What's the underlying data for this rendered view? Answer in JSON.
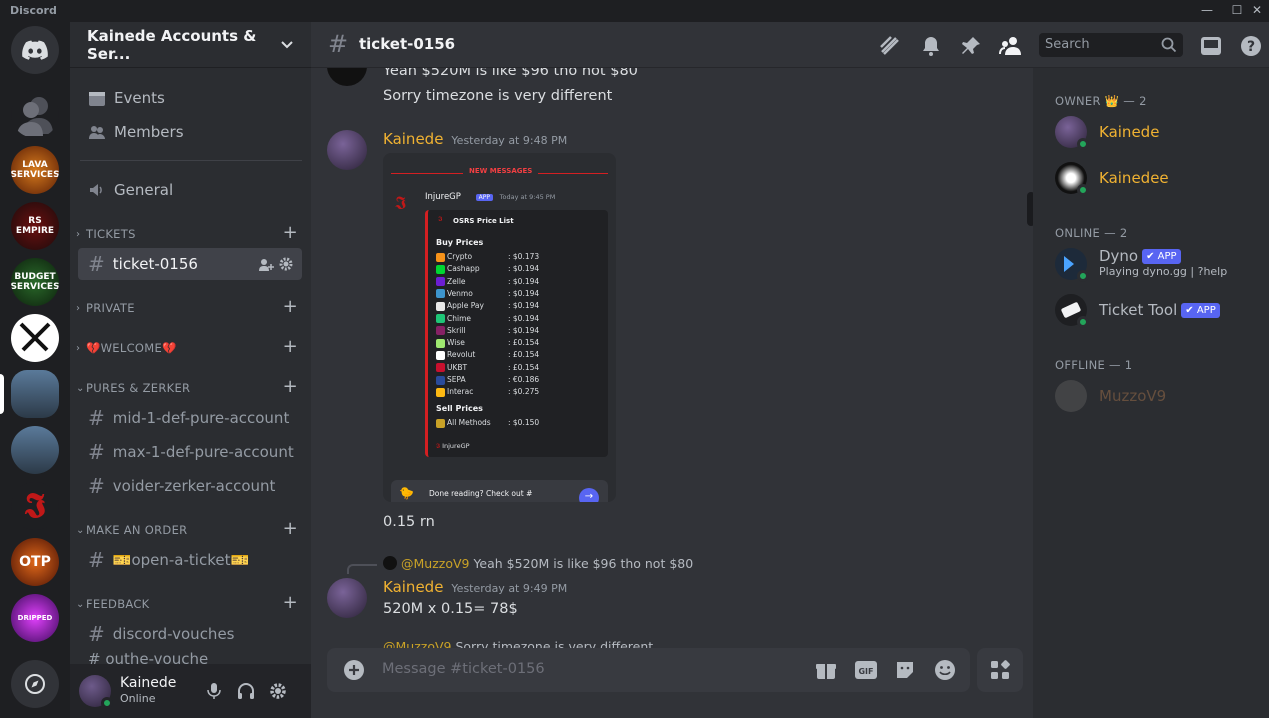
{
  "app": {
    "title": "Discord"
  },
  "window": {
    "min": "—",
    "max": "☐",
    "close": "✕"
  },
  "guild_icons": [
    {
      "name": "home",
      "label": ""
    },
    {
      "name": "dm-avatar",
      "label": ""
    },
    {
      "name": "lava-services",
      "label": "LAVA SERVICES"
    },
    {
      "name": "rs-empire",
      "label": "RS EMPIRE"
    },
    {
      "name": "budget-services",
      "label": "BUDGET SERVICES"
    },
    {
      "name": "swords",
      "label": ""
    },
    {
      "name": "kainede-1",
      "label": ""
    },
    {
      "name": "kainede-2",
      "label": ""
    },
    {
      "name": "injure",
      "label": ""
    },
    {
      "name": "otp",
      "label": "OTP"
    },
    {
      "name": "dripped",
      "label": "DRIPPED"
    }
  ],
  "server": {
    "name": "Kainede Accounts & Ser..."
  },
  "nav": {
    "events": "Events",
    "members": "Members"
  },
  "channels": {
    "general": "General",
    "cat_tickets": "TICKETS",
    "ticket": "ticket-0156",
    "cat_private": "PRIVATE",
    "cat_welcome": "💔WELCOME💔",
    "cat_pures": "PURES & ZERKER",
    "mid_pure": "mid-1-def-pure-account",
    "max_pure": "max-1-def-pure-account",
    "voider": "voider-zerker-account",
    "cat_order": "MAKE AN ORDER",
    "open_ticket": "🎫open-a-ticket🎫",
    "cat_feedback": "FEEDBACK",
    "vouches": "discord-vouches",
    "partial": "# outhe-vouche"
  },
  "user": {
    "name": "Kainede",
    "status": "Online"
  },
  "topbar": {
    "channel": "ticket-0156",
    "search_placeholder": "Search"
  },
  "messages": {
    "line1": "Yeah $520M is like $96 tho not $80",
    "line2": "Sorry timezone is very different",
    "author1": "Kainede",
    "time1": "Yesterday at 9:48 PM",
    "after_embed": "0.15 rn",
    "reply_user": "@MuzzoV9",
    "reply_text": "Yeah $520M is like $96 tho not $80",
    "author2": "Kainede",
    "time2": "Yesterday at 9:49 PM",
    "calc": "520M x 0.15= 78$",
    "partial_reply_user": "@MuzzoV9",
    "partial_reply_text": "Sorry timezone is very different"
  },
  "embed": {
    "new_messages": "NEW MESSAGES",
    "bot": "InjureGP",
    "app": "APP",
    "time": "Today at 9:45 PM",
    "title": "OSRS Price List",
    "buy_header": "Buy Prices",
    "buy": [
      {
        "method": "Crypto",
        "price": ": $0.173",
        "color": "#f7931a"
      },
      {
        "method": "Cashapp",
        "price": ": $0.194",
        "color": "#00d632"
      },
      {
        "method": "Zelle",
        "price": ": $0.194",
        "color": "#6d1ed4"
      },
      {
        "method": "Venmo",
        "price": ": $0.194",
        "color": "#3d95ce"
      },
      {
        "method": "Apple Pay",
        "price": ": $0.194",
        "color": "#e8e8e8"
      },
      {
        "method": "Chime",
        "price": ": $0.194",
        "color": "#1ec677"
      },
      {
        "method": "Skrill",
        "price": ": $0.194",
        "color": "#862165"
      },
      {
        "method": "Wise",
        "price": ": £0.154",
        "color": "#9fe870"
      },
      {
        "method": "Revolut",
        "price": ": £0.154",
        "color": "#ffffff"
      },
      {
        "method": "UKBT",
        "price": ": £0.154",
        "color": "#c8102e"
      },
      {
        "method": "SEPA",
        "price": ": €0.186",
        "color": "#2a4b9b"
      },
      {
        "method": "Interac",
        "price": ": $0.275",
        "color": "#fdb913"
      }
    ],
    "sell_header": "Sell Prices",
    "sell": [
      {
        "method": "All Methods",
        "price": ": $0.150",
        "color": "#c9a227"
      }
    ],
    "footer": "InjureGP",
    "done": "Done reading? Check out #"
  },
  "composer": {
    "placeholder": "Message #ticket-0156"
  },
  "member_list": {
    "owner_header": "OWNER 👑 — 2",
    "owners": [
      {
        "name": "Kainede",
        "color": "#f0b232"
      },
      {
        "name": "Kainedee",
        "color": "#f0b232"
      }
    ],
    "online_header": "ONLINE — 2",
    "online": [
      {
        "name": "Dyno",
        "badge": "✔ APP",
        "activity": "Playing dyno.gg | ?help"
      },
      {
        "name": "Ticket Tool",
        "badge": "✔ APP"
      }
    ],
    "offline_header": "OFFLINE — 1",
    "offline": [
      {
        "name": "MuzzoV9",
        "color": "#6b4a2a"
      }
    ]
  }
}
